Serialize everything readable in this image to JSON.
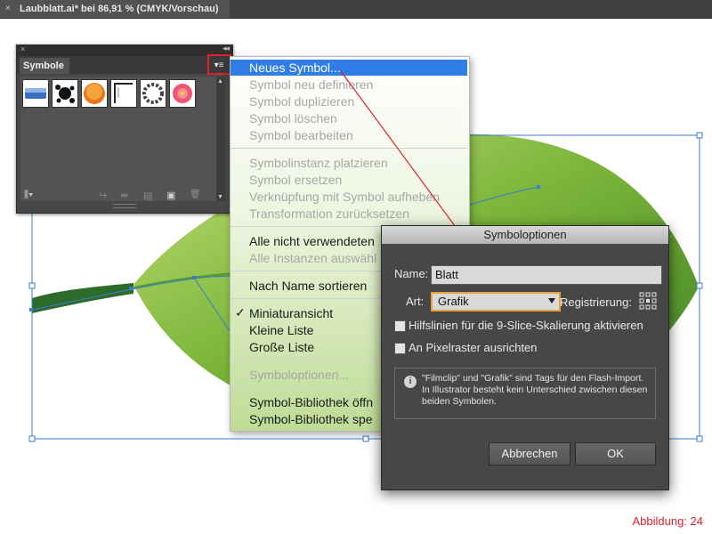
{
  "document_tab": {
    "close": "×",
    "title": "Laubblatt.ai* bei 86,91 % (CMYK/Vorschau)"
  },
  "symbols_panel": {
    "close": "×",
    "collapse": "◂◂",
    "tab_label": "Symbole",
    "menu_glyph": "▾≡",
    "scroll_up": "▲",
    "scroll_down": "▼",
    "swatches": [
      "gradient-bar-symbol",
      "ink-splatter-symbol",
      "orange-button-symbol",
      "frame-corner-symbol",
      "ornament-ring-symbol",
      "flower-symbol"
    ],
    "tools": {
      "library": "⫼▾",
      "place": "↪",
      "break_link": "⇹",
      "options": "▤",
      "new": "▣",
      "delete": "🗑"
    }
  },
  "flyout_menu": {
    "groups": [
      [
        {
          "label": "Neues Symbol...",
          "state": "selected"
        },
        {
          "label": "Symbol neu definieren",
          "state": "disabled"
        },
        {
          "label": "Symbol duplizieren",
          "state": "disabled"
        },
        {
          "label": "Symbol löschen",
          "state": "disabled"
        },
        {
          "label": "Symbol bearbeiten",
          "state": "disabled"
        }
      ],
      [
        {
          "label": "Symbolinstanz platzieren",
          "state": "disabled"
        },
        {
          "label": "Symbol ersetzen",
          "state": "disabled"
        },
        {
          "label": "Verknüpfung mit Symbol aufheben",
          "state": "disabled"
        },
        {
          "label": "Transformation zurücksetzen",
          "state": "disabled"
        }
      ],
      [
        {
          "label": "Alle nicht verwendeten",
          "state": "enabled"
        },
        {
          "label": "Alle Instanzen auswähl",
          "state": "disabled"
        }
      ],
      [
        {
          "label": "Nach Name sortieren",
          "state": "enabled"
        }
      ],
      [
        {
          "label": "Miniaturansicht",
          "state": "checked"
        },
        {
          "label": "Kleine Liste",
          "state": "enabled"
        },
        {
          "label": "Große Liste",
          "state": "enabled"
        }
      ],
      [
        {
          "label": "Symboloptionen...",
          "state": "disabled"
        }
      ],
      [
        {
          "label": "Symbol-Bibliothek öffn",
          "state": "enabled"
        },
        {
          "label": "Symbol-Bibliothek spe",
          "state": "enabled"
        }
      ]
    ],
    "check_glyph": "✓"
  },
  "dialog": {
    "title": "Symboloptionen",
    "name_label": "Name:",
    "name_value": "Blatt",
    "type_label": "Art:",
    "type_value": "Grafik",
    "registration_label": "Registrierung:",
    "checkbox_9slice": "Hilfslinien für die 9-Slice-Skalierung aktivieren",
    "checkbox_pixel": "An Pixelraster ausrichten",
    "info_icon": "i",
    "info_text": "\"Filmclip\" und \"Grafik\" sind Tags für den Flash-Import. In Illustrator besteht kein Unterschied zwischen diesen beiden Symbolen.",
    "cancel": "Abbrechen",
    "ok": "OK"
  },
  "caption": "Abbildung: 24",
  "colors": {
    "highlight": "#2f7ee8",
    "callout_red": "#e0202a",
    "leaf_green": "#6fae2e",
    "leaf_dark": "#1f5c2a",
    "selection_blue": "#3a7bd5"
  }
}
